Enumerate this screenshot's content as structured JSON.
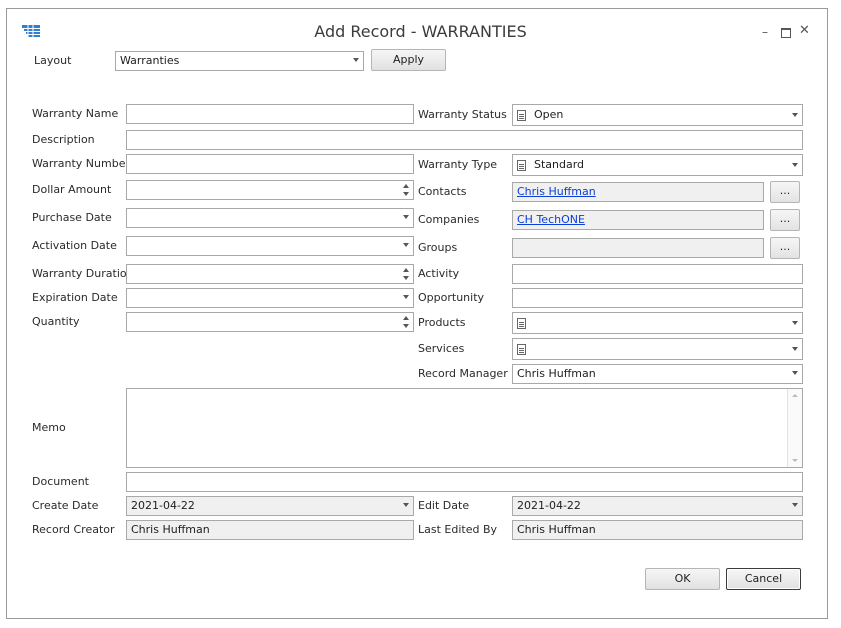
{
  "window": {
    "title": "Add Record - WARRANTIES"
  },
  "layout": {
    "label": "Layout",
    "value": "Warranties",
    "apply": "Apply"
  },
  "fields": {
    "warranty_name": {
      "label": "Warranty Name",
      "value": ""
    },
    "description": {
      "label": "Description",
      "value": ""
    },
    "warranty_number": {
      "label": "Warranty Number",
      "value": ""
    },
    "dollar_amount": {
      "label": "Dollar Amount",
      "value": ""
    },
    "purchase_date": {
      "label": "Purchase Date",
      "value": ""
    },
    "activation_date": {
      "label": "Activation Date",
      "value": ""
    },
    "warranty_duration": {
      "label": "Warranty Duration",
      "value": ""
    },
    "expiration_date": {
      "label": "Expiration Date",
      "value": ""
    },
    "quantity": {
      "label": "Quantity",
      "value": ""
    },
    "warranty_status": {
      "label": "Warranty Status",
      "value": "Open"
    },
    "warranty_type": {
      "label": "Warranty Type",
      "value": "Standard"
    },
    "contacts": {
      "label": "Contacts",
      "value": "Chris Huffman",
      "button": "..."
    },
    "companies": {
      "label": "Companies",
      "value": "CH TechONE",
      "button": "..."
    },
    "groups": {
      "label": "Groups",
      "value": "",
      "button": "..."
    },
    "activity": {
      "label": "Activity",
      "value": ""
    },
    "opportunity": {
      "label": "Opportunity",
      "value": ""
    },
    "products": {
      "label": "Products",
      "value": ""
    },
    "services": {
      "label": "Services",
      "value": ""
    },
    "record_manager": {
      "label": "Record Manager",
      "value": "Chris Huffman"
    },
    "memo": {
      "label": "Memo",
      "value": ""
    },
    "document": {
      "label": "Document",
      "value": ""
    },
    "create_date": {
      "label": "Create Date",
      "value": "2021-04-22"
    },
    "edit_date": {
      "label": "Edit Date",
      "value": "2021-04-22"
    },
    "record_creator": {
      "label": "Record Creator",
      "value": "Chris Huffman"
    },
    "last_edited_by": {
      "label": "Last Edited By",
      "value": "Chris Huffman"
    }
  },
  "buttons": {
    "ok": "OK",
    "cancel": "Cancel"
  },
  "colors": {
    "link": "#0b3fd6",
    "readonly_bg": "#f0f0f0",
    "app_icon": "#2f7fd1"
  }
}
